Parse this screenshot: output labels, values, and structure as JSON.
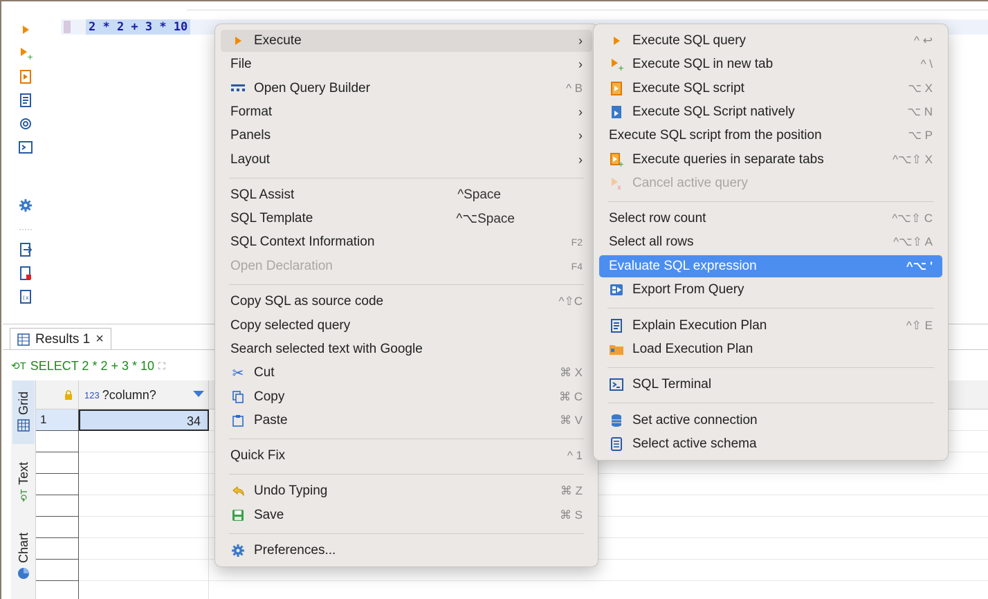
{
  "editor": {
    "code": "2 * 2 + 3 * 10"
  },
  "toolbar_icons": [
    "execute-icon",
    "execute-new-tab-icon",
    "execute-script-icon",
    "explain-plan-icon",
    "ai-assist-icon",
    "terminal-icon",
    "settings-icon",
    "export-icon",
    "new-file-icon",
    "variables-icon"
  ],
  "results": {
    "tab_label": "Results 1",
    "close_glyph": "×",
    "query_text": "SELECT 2 * 2 + 3 * 10",
    "side_tabs": [
      "Grid",
      "Text",
      "Chart"
    ],
    "column_type": "123",
    "column_name": "?column?",
    "rows": [
      {
        "num": "1",
        "value": "34"
      }
    ]
  },
  "main_menu": {
    "items": [
      {
        "label": "Execute",
        "submenu": true,
        "icon": "execute-icon"
      },
      {
        "label": "File",
        "submenu": true
      },
      {
        "label": "Open Query Builder",
        "shortcut": "^ B",
        "icon": "query-builder-icon"
      },
      {
        "label": "Format",
        "submenu": true
      },
      {
        "label": "Panels",
        "submenu": true
      },
      {
        "label": "Layout",
        "submenu": true
      },
      {
        "label": "SQL Assist",
        "shortcut": "^Space"
      },
      {
        "label": "SQL Template",
        "shortcut": "^⌥Space"
      },
      {
        "label": "SQL Context Information",
        "shortcut": "F2"
      },
      {
        "label": "Open Declaration",
        "shortcut": "F4",
        "disabled": true
      },
      {
        "label": "Copy SQL as source code",
        "shortcut": "^⇧C"
      },
      {
        "label": "Copy selected query"
      },
      {
        "label": "Search selected text with Google"
      },
      {
        "label": "Cut",
        "shortcut": "⌘ X",
        "icon": "scissors-icon"
      },
      {
        "label": "Copy",
        "shortcut": "⌘ C",
        "icon": "copy-icon"
      },
      {
        "label": "Paste",
        "shortcut": "⌘ V",
        "icon": "paste-icon"
      },
      {
        "label": "Quick Fix",
        "shortcut": "^ 1"
      },
      {
        "label": "Undo Typing",
        "shortcut": "⌘ Z",
        "icon": "undo-icon"
      },
      {
        "label": "Save",
        "shortcut": "⌘ S",
        "icon": "save-icon"
      },
      {
        "label": "Preferences...",
        "icon": "gear-icon"
      }
    ],
    "submenu_arrow": "›"
  },
  "execute_submenu": {
    "items": [
      {
        "label": "Execute SQL query",
        "shortcut": "^ ↩"
      },
      {
        "label": "Execute SQL in new tab",
        "shortcut": "^ \\"
      },
      {
        "label": "Execute SQL script",
        "shortcut": "⌥ X"
      },
      {
        "label": "Execute SQL Script natively",
        "shortcut": "⌥ N"
      },
      {
        "label": "Execute SQL script from the position",
        "shortcut": "⌥ P"
      },
      {
        "label": "Execute queries in separate tabs",
        "shortcut": "^⌥⇧ X"
      },
      {
        "label": "Cancel active query",
        "disabled": true
      },
      {
        "label": "Select row count",
        "shortcut": "^⌥⇧ C"
      },
      {
        "label": "Select all rows",
        "shortcut": "^⌥⇧ A"
      },
      {
        "label": "Evaluate SQL expression",
        "shortcut": "^⌥ '"
      },
      {
        "label": "Export From Query"
      },
      {
        "label": "Explain Execution Plan",
        "shortcut": "^⇧ E"
      },
      {
        "label": "Load Execution Plan"
      },
      {
        "label": "SQL Terminal"
      },
      {
        "label": "Set active connection"
      },
      {
        "label": "Select active schema"
      }
    ]
  },
  "colors": {
    "selection": "#4b8ef0",
    "execute_orange": "#f08a00",
    "menu_bg": "#ebe8e5"
  }
}
